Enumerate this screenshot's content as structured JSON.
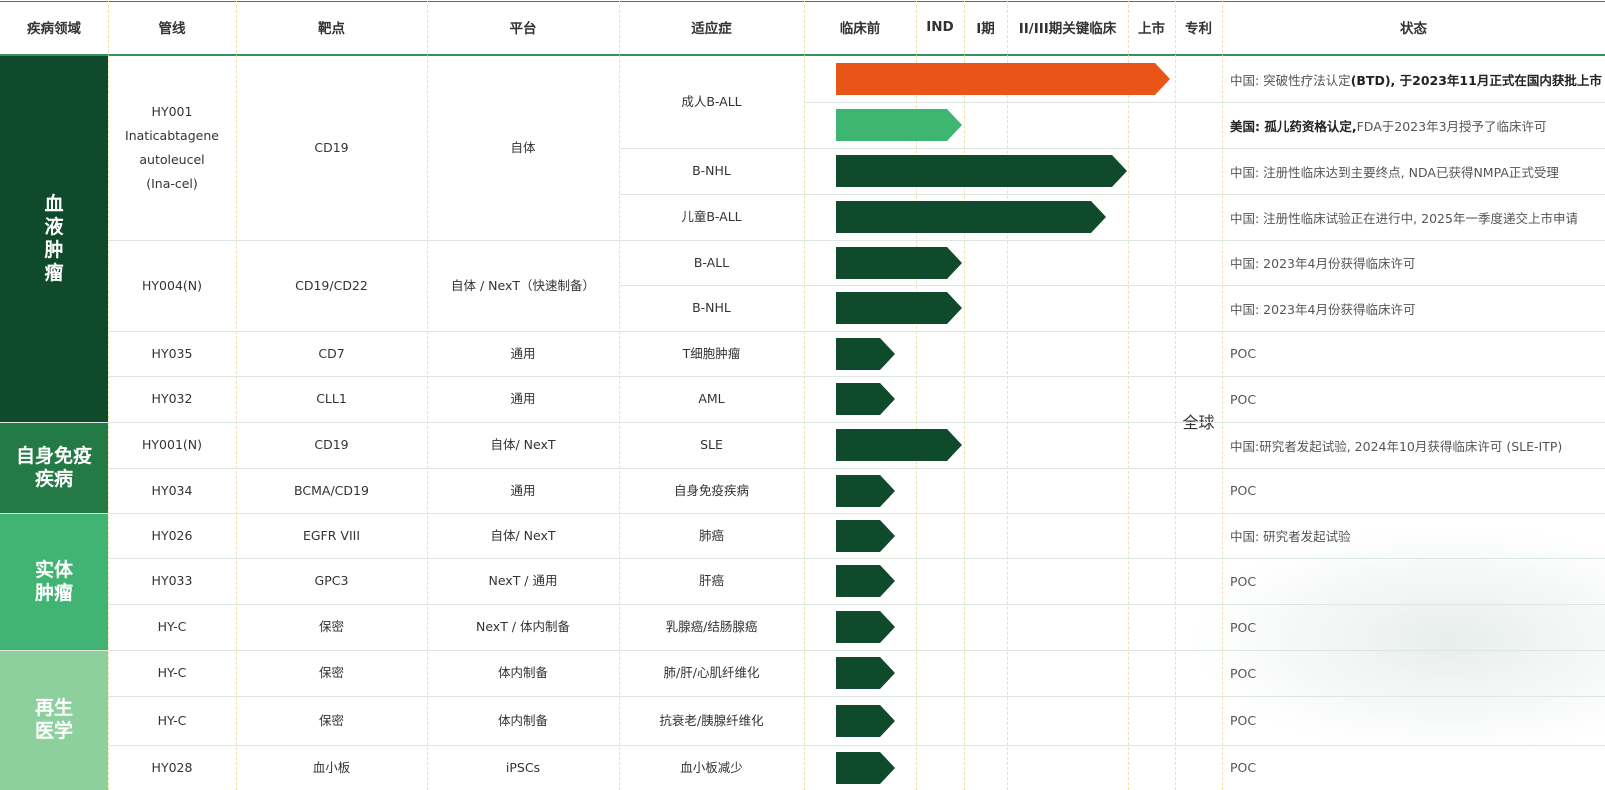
{
  "headers": {
    "area": "疾病领域",
    "pipeline": "管线",
    "target": "靶点",
    "platform": "平台",
    "indication": "适应症",
    "preclinical": "临床前",
    "ind": "IND",
    "phase1": "I期",
    "phase23": "II/III期关键临床",
    "market": "上市",
    "patent": "专利",
    "status": "状态"
  },
  "areas": [
    {
      "label": "血液肿瘤",
      "color": "#0f4a2c"
    },
    {
      "label": "自身免疫疾病",
      "color": "#237a45"
    },
    {
      "label": "实体肿瘤",
      "color": "#41b474"
    },
    {
      "label": "再生医学",
      "color": "#8ecf9e"
    }
  ],
  "patent_value": "全球",
  "groups": [
    {
      "pipeline_lines": [
        "HY001",
        "Inaticabtagene",
        "autoleucel",
        "(Ina-cel)"
      ],
      "target": "CD19",
      "platform": "自体"
    },
    {
      "pipeline_lines": [
        "HY004(N)"
      ],
      "target": "CD19/CD22",
      "platform": "自体 / NexT（快速制备）"
    },
    {
      "pipeline_lines": [
        "HY035"
      ],
      "target": "CD7",
      "platform": "通用"
    },
    {
      "pipeline_lines": [
        "HY032"
      ],
      "target": "CLL1",
      "platform": "通用"
    },
    {
      "pipeline_lines": [
        "HY001(N)"
      ],
      "target": "CD19",
      "platform": "自体/ NexT"
    },
    {
      "pipeline_lines": [
        "HY034"
      ],
      "target": "BCMA/CD19",
      "platform": "通用"
    },
    {
      "pipeline_lines": [
        "HY026"
      ],
      "target": "EGFR VIII",
      "platform": "自体/ NexT"
    },
    {
      "pipeline_lines": [
        "HY033"
      ],
      "target": "GPC3",
      "platform": "NexT / 通用"
    },
    {
      "pipeline_lines": [
        "HY-C"
      ],
      "target": "保密",
      "platform": "NexT / 体内制备"
    },
    {
      "pipeline_lines": [
        "HY-C"
      ],
      "target": "保密",
      "platform": "体内制备"
    },
    {
      "pipeline_lines": [
        "HY-C"
      ],
      "target": "保密",
      "platform": "体内制备"
    },
    {
      "pipeline_lines": [
        "HY028"
      ],
      "target": "血小板",
      "platform": "iPSCs"
    }
  ],
  "indications": [
    "成人B-ALL",
    "B-NHL",
    "儿童B-ALL",
    "B-ALL",
    "B-NHL",
    "T细胞肿瘤",
    "AML",
    "SLE",
    "自身免疫疾病",
    "肺癌",
    "肝癌",
    "乳腺癌/结肠腺癌",
    "肺/肝/心肌纤维化",
    "抗衰老/胰腺纤维化",
    "血小板减少"
  ],
  "progress": [
    {
      "stage": "上市",
      "color": "#e85516"
    },
    {
      "stage": "IND",
      "color": "#3fb572"
    },
    {
      "stage": "II/III期关键临床",
      "color": "#0f4a2c"
    },
    {
      "stage": "II/III期关键临床",
      "color": "#0f4a2c"
    },
    {
      "stage": "IND",
      "color": "#0f4a2c"
    },
    {
      "stage": "IND",
      "color": "#0f4a2c"
    },
    {
      "stage": "临床前",
      "color": "#0f4a2c"
    },
    {
      "stage": "临床前",
      "color": "#0f4a2c"
    },
    {
      "stage": "IND",
      "color": "#0f4a2c"
    },
    {
      "stage": "临床前",
      "color": "#0f4a2c"
    },
    {
      "stage": "临床前",
      "color": "#0f4a2c"
    },
    {
      "stage": "临床前",
      "color": "#0f4a2c"
    },
    {
      "stage": "临床前",
      "color": "#0f4a2c"
    },
    {
      "stage": "临床前",
      "color": "#0f4a2c"
    },
    {
      "stage": "临床前",
      "color": "#0f4a2c"
    },
    {
      "stage": "临床前",
      "color": "#0f4a2c"
    }
  ],
  "statuses": [
    {
      "a": "中国: 突破性疗法认定",
      "b": "(BTD), 于2023年11月正式在国内获批上市",
      "c": ""
    },
    {
      "a": "",
      "b": "美国: 孤儿药资格认定,",
      "c": " FDA于2023年3月授予了临床许可"
    },
    {
      "a": "中国: 注册性临床达到主要终点, NDA已获得NMPA正式受理",
      "b": "",
      "c": ""
    },
    {
      "a": "中国: 注册性临床试验正在进行中, 2025年一季度递交上市申请",
      "b": "",
      "c": ""
    },
    {
      "a": "中国: 2023年4月份获得临床许可",
      "b": "",
      "c": ""
    },
    {
      "a": "中国: 2023年4月份获得临床许可",
      "b": "",
      "c": ""
    },
    {
      "a": "POC",
      "b": "",
      "c": ""
    },
    {
      "a": "POC",
      "b": "",
      "c": ""
    },
    {
      "a": "中国:研究者发起试验, 2024年10月获得临床许可 (SLE-ITP)",
      "b": "",
      "c": ""
    },
    {
      "a": "POC",
      "b": "",
      "c": ""
    },
    {
      "a": "中国: 研究者发起试验",
      "b": "",
      "c": ""
    },
    {
      "a": "POC",
      "b": "",
      "c": ""
    },
    {
      "a": "POC",
      "b": "",
      "c": ""
    },
    {
      "a": "POC",
      "b": "",
      "c": ""
    },
    {
      "a": "POC",
      "b": "",
      "c": ""
    },
    {
      "a": "POC",
      "b": "",
      "c": ""
    }
  ]
}
